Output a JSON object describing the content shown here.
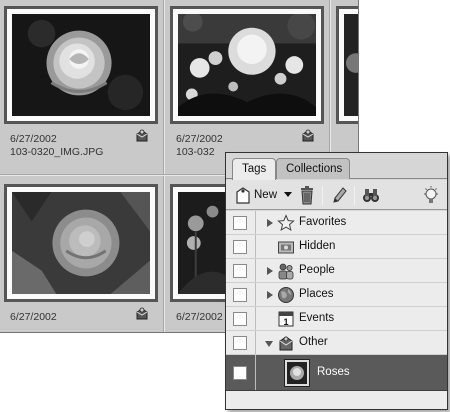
{
  "photos": [
    {
      "date": "6/27/2002",
      "filename": "103-0320_IMG.JPG"
    },
    {
      "date": "6/27/2002",
      "filename": "103-032"
    },
    {
      "date": "",
      "filename": ""
    },
    {
      "date": "6/27/2002",
      "filename": ""
    },
    {
      "date": "6/27/2002",
      "filename": ""
    }
  ],
  "panel": {
    "tabs": [
      {
        "label": "Tags",
        "active": true
      },
      {
        "label": "Collections",
        "active": false
      }
    ],
    "toolbar": {
      "new_label": "New",
      "icons": [
        "new-tag-icon",
        "delete-icon",
        "edit-pencil-icon",
        "find-binoculars-icon",
        "lightbulb-icon"
      ]
    },
    "tags": [
      {
        "label": "Favorites",
        "icon": "star-icon",
        "expandable": true,
        "expanded": false
      },
      {
        "label": "Hidden",
        "icon": "hidden-icon",
        "expandable": false,
        "expanded": false
      },
      {
        "label": "People",
        "icon": "people-icon",
        "expandable": true,
        "expanded": false
      },
      {
        "label": "Places",
        "icon": "globe-icon",
        "expandable": true,
        "expanded": false
      },
      {
        "label": "Events",
        "icon": "calendar-icon",
        "expandable": false,
        "expanded": false
      },
      {
        "label": "Other",
        "icon": "tag-icon",
        "expandable": true,
        "expanded": true
      },
      {
        "label": "Roses",
        "icon": "rose-thumbnail",
        "expandable": false,
        "selected": true
      }
    ]
  },
  "colors": {
    "grid_bg": "#c9c9c9",
    "panel_bg": "#d6d6d6",
    "selected_row": "#5a5a5a"
  }
}
